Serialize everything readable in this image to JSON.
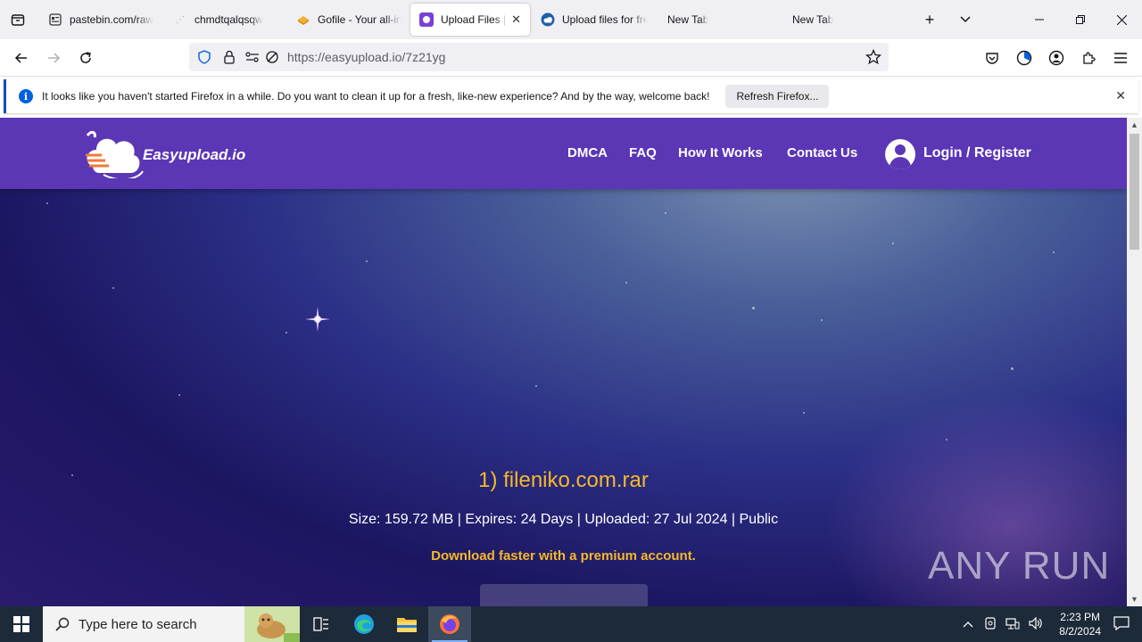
{
  "browser": {
    "tabs": [
      {
        "title": "pastebin.com/raw",
        "active": false
      },
      {
        "title": "chmdtqalqsqw",
        "active": false
      },
      {
        "title": "Gofile - Your all-in",
        "active": false
      },
      {
        "title": "Upload Files | Fr",
        "active": true
      },
      {
        "title": "Upload files for fre",
        "active": false
      },
      {
        "title": "New Tab",
        "active": false
      },
      {
        "title": "New Tab",
        "active": false
      }
    ],
    "new_tab": "+",
    "tab_list": "⌵",
    "url": "https://easyupload.io/7z21yg"
  },
  "notification": {
    "message": "It looks like you haven't started Firefox in a while. Do you want to clean it up for a fresh, like-new experience? And by the way, welcome back!",
    "button": "Refresh Firefox..."
  },
  "site": {
    "logo_text": "Easyupload.io",
    "nav": {
      "dmca": "DMCA",
      "faq": "FAQ",
      "how": "How It Works",
      "contact": "Contact Us",
      "login": "Login / Register"
    },
    "file": {
      "title": "1) fileniko.com.rar",
      "meta": "Size: 159.72 MB | Expires: 24 Days | Uploaded: 27 Jul 2024 | Public",
      "premium": "Download faster with a premium account."
    }
  },
  "watermark": "ANY RUN",
  "taskbar": {
    "search_placeholder": "Type here to search",
    "time": "2:23 PM",
    "date": "8/2/2024"
  },
  "colors": {
    "header": "#5b36b5",
    "accent_yellow": "#f5b829",
    "firefox_blue": "#0060df"
  }
}
